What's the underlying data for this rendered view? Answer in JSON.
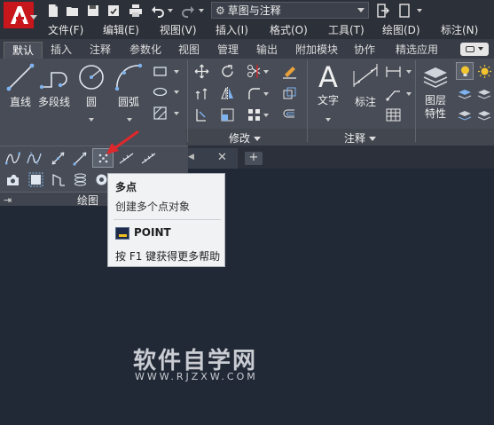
{
  "workspace": {
    "name": "草图与注释"
  },
  "menubar": [
    "文件(F)",
    "编辑(E)",
    "视图(V)",
    "插入(I)",
    "格式(O)",
    "工具(T)",
    "绘图(D)",
    "标注(N)"
  ],
  "ribbon_tabs": [
    "默认",
    "插入",
    "注释",
    "参数化",
    "视图",
    "管理",
    "输出",
    "附加模块",
    "协作",
    "精选应用"
  ],
  "draw_tools": {
    "line": "直线",
    "polyline": "多段线",
    "circle": "圆",
    "arc": "圆弧"
  },
  "annotation_tools": {
    "text": "文字",
    "dimension": "标注"
  },
  "layer_tools": {
    "layer_props": "图层\n特性"
  },
  "panels": {
    "modify": "修改",
    "annotation": "注释",
    "draw": "绘图"
  },
  "tooltip": {
    "title": "多点",
    "description": "创建多个点对象",
    "command": "POINT",
    "help": "按 F1 键获得更多帮助",
    "help_key": "F1"
  },
  "watermark": {
    "main": "软件自学网",
    "sub": "WWW.RJZXW.COM"
  },
  "colors": {
    "accent_red": "#d6262b",
    "pointer_arrow": "#e0282c",
    "highlight": "#f2c530",
    "bg": "#222936"
  }
}
